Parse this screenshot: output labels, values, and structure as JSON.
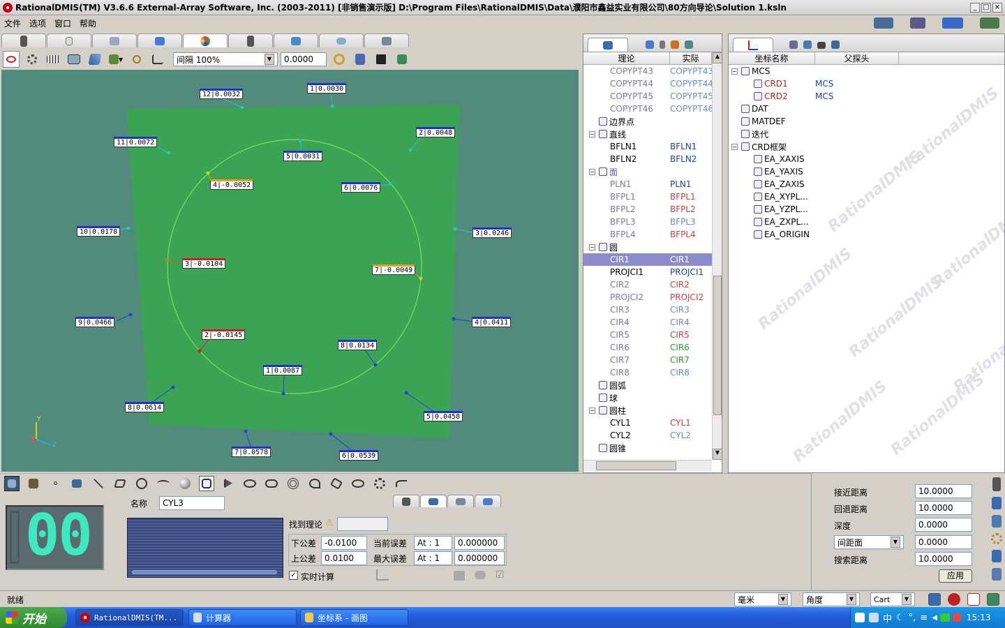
{
  "window": {
    "title": "RationalDMIS(TM) V3.6.6    External-Array Software, Inc. (2003-2011) [非销售演示版]          D:\\Program Files\\RationalDMIS\\Data\\濮阳市鑫益实业有限公司\\80方向导论\\Solution 1.ksln"
  },
  "menu": [
    "文件",
    "选项",
    "窗口",
    "帮助"
  ],
  "toolbar": {
    "mode_value": "间隔  100%",
    "number_value": "0.0000"
  },
  "viewport": {
    "labels": [
      {
        "text": "12|0.0032",
        "cls": ""
      },
      {
        "text": "1|0.0030",
        "cls": ""
      },
      {
        "text": "2|0.0048",
        "cls": ""
      },
      {
        "text": "11|0.0072",
        "cls": ""
      },
      {
        "text": "5|0.0031",
        "cls": ""
      },
      {
        "text": "4|-0.0052",
        "cls": "o"
      },
      {
        "text": "6|0.0076",
        "cls": ""
      },
      {
        "text": "10|0.0178",
        "cls": ""
      },
      {
        "text": "3|0.0246",
        "cls": ""
      },
      {
        "text": "3|-0.0104",
        "cls": "r"
      },
      {
        "text": "7|-0.0049",
        "cls": "o"
      },
      {
        "text": "9|0.0466",
        "cls": ""
      },
      {
        "text": "4|0.0411",
        "cls": ""
      },
      {
        "text": "2|-0.0145",
        "cls": "r"
      },
      {
        "text": "8|0.0134",
        "cls": ""
      },
      {
        "text": "1|0.0087",
        "cls": ""
      },
      {
        "text": "8|0.0614",
        "cls": ""
      },
      {
        "text": "5|0.0458",
        "cls": ""
      },
      {
        "text": "7|0.0578",
        "cls": ""
      },
      {
        "text": "6|0.0539",
        "cls": ""
      }
    ],
    "axis_y": "Y",
    "axis_z": "Z",
    "axis_x": "X"
  },
  "feature_panel": {
    "col_nominal": "理论",
    "col_actual": "实际",
    "rows": [
      {
        "indent": 2,
        "name": "COPYPT43",
        "actual": "COPYPT43",
        "nc": "#7a7a9a",
        "ac": "#6a8ad0",
        "icon": ""
      },
      {
        "indent": 2,
        "name": "COPYPT44",
        "actual": "COPYPT44",
        "nc": "#7a7a9a",
        "ac": "#6a8ad0",
        "icon": ""
      },
      {
        "indent": 2,
        "name": "COPYPT45",
        "actual": "COPYPT45",
        "nc": "#7a7a9a",
        "ac": "#6a8ad0",
        "icon": ""
      },
      {
        "indent": 2,
        "name": "COPYPT46",
        "actual": "COPYPT46",
        "nc": "#7a7a9a",
        "ac": "#6a8ad0",
        "icon": ""
      },
      {
        "indent": 1,
        "name": "边界点",
        "actual": "",
        "nc": "#000",
        "ac": "#000",
        "icon": "y"
      },
      {
        "indent": 1,
        "name": "直线",
        "actual": "",
        "nc": "#000",
        "ac": "#000",
        "icon": "y",
        "pm": "−"
      },
      {
        "indent": 2,
        "name": "BFLN1",
        "actual": "BFLN1",
        "nc": "#000",
        "ac": "#1a3fb0",
        "icon": ""
      },
      {
        "indent": 2,
        "name": "BFLN2",
        "actual": "BFLN2",
        "nc": "#000",
        "ac": "#1a3fb0",
        "icon": ""
      },
      {
        "indent": 1,
        "name": "面",
        "actual": "",
        "nc": "#5a5aa0",
        "ac": "#000",
        "icon": "y",
        "pm": "−"
      },
      {
        "indent": 2,
        "name": "PLN1",
        "actual": "PLN1",
        "nc": "#7a7a9a",
        "ac": "#1a3fb0",
        "icon": ""
      },
      {
        "indent": 2,
        "name": "BFPL1",
        "actual": "BFPL1",
        "nc": "#7a7a9a",
        "ac": "#d04040",
        "icon": ""
      },
      {
        "indent": 2,
        "name": "BFPL2",
        "actual": "BFPL2",
        "nc": "#7a7a9a",
        "ac": "#d04040",
        "icon": ""
      },
      {
        "indent": 2,
        "name": "BFPL3",
        "actual": "BFPL3",
        "nc": "#7a7a9a",
        "ac": "#6a8ad0",
        "icon": ""
      },
      {
        "indent": 2,
        "name": "BFPL4",
        "actual": "BFPL4",
        "nc": "#7a7a9a",
        "ac": "#d04040",
        "icon": ""
      },
      {
        "indent": 1,
        "name": "圆",
        "actual": "",
        "nc": "#000",
        "ac": "#000",
        "icon": "y",
        "pm": "−"
      },
      {
        "indent": 2,
        "name": "CIR1",
        "actual": "CIR1",
        "nc": "#fff",
        "ac": "#fff",
        "icon": "",
        "sel": true
      },
      {
        "indent": 2,
        "name": "PROJCI1",
        "actual": "PROJCI1",
        "nc": "#000",
        "ac": "#1a3fb0",
        "icon": ""
      },
      {
        "indent": 2,
        "name": "CIR2",
        "actual": "CIR2",
        "nc": "#7a7a9a",
        "ac": "#d04040",
        "icon": ""
      },
      {
        "indent": 2,
        "name": "PROJCI2",
        "actual": "PROJCI2",
        "nc": "#7a7a9a",
        "ac": "#d04040",
        "icon": ""
      },
      {
        "indent": 2,
        "name": "CIR3",
        "actual": "CIR3",
        "nc": "#7a7a9a",
        "ac": "#6a8ad0",
        "icon": ""
      },
      {
        "indent": 2,
        "name": "CIR4",
        "actual": "CIR4",
        "nc": "#7a7a9a",
        "ac": "#6a8ad0",
        "icon": ""
      },
      {
        "indent": 2,
        "name": "CIR5",
        "actual": "CIR5",
        "nc": "#7a7a9a",
        "ac": "#d04040",
        "icon": ""
      },
      {
        "indent": 2,
        "name": "CIR6",
        "actual": "CIR6",
        "nc": "#7a7a9a",
        "ac": "#2a9a3a",
        "icon": ""
      },
      {
        "indent": 2,
        "name": "CIR7",
        "actual": "CIR7",
        "nc": "#7a7a9a",
        "ac": "#2a9a3a",
        "icon": ""
      },
      {
        "indent": 2,
        "name": "CIR8",
        "actual": "CIR8",
        "nc": "#7a7a9a",
        "ac": "#6a8ad0",
        "icon": ""
      },
      {
        "indent": 1,
        "name": "圆弧",
        "actual": "",
        "nc": "#000",
        "ac": "#000",
        "icon": "y"
      },
      {
        "indent": 1,
        "name": "球",
        "actual": "",
        "nc": "#000",
        "ac": "#000",
        "icon": "y"
      },
      {
        "indent": 1,
        "name": "圆柱",
        "actual": "",
        "nc": "#000",
        "ac": "#000",
        "icon": "y",
        "pm": "−"
      },
      {
        "indent": 2,
        "name": "CYL1",
        "actual": "CYL1",
        "nc": "#000",
        "ac": "#d04040",
        "icon": ""
      },
      {
        "indent": 2,
        "name": "CYL2",
        "actual": "CYL2",
        "nc": "#000",
        "ac": "#6a8ad0",
        "icon": ""
      },
      {
        "indent": 1,
        "name": "圆锥",
        "actual": "",
        "nc": "#000",
        "ac": "#000",
        "icon": "y"
      }
    ]
  },
  "coord_panel": {
    "col_name": "坐标名称",
    "col_parent": "父探头",
    "rows": [
      {
        "indent": 0,
        "name": "MCS",
        "parent": "",
        "nc": "#000",
        "pm": "−"
      },
      {
        "indent": 1,
        "name": "CRD1",
        "parent": "MCS",
        "nc": "#c02020"
      },
      {
        "indent": 1,
        "name": "CRD2",
        "parent": "MCS",
        "nc": "#c02020"
      },
      {
        "indent": 0,
        "name": "DAT",
        "parent": "",
        "nc": "#000"
      },
      {
        "indent": 0,
        "name": "MATDEF",
        "parent": "",
        "nc": "#000"
      },
      {
        "indent": 0,
        "name": "迭代",
        "parent": "",
        "nc": "#000"
      },
      {
        "indent": 0,
        "name": "CRD框架",
        "parent": "",
        "nc": "#000",
        "pm": "−"
      },
      {
        "indent": 1,
        "name": "EA_XAXIS",
        "parent": "",
        "nc": "#000"
      },
      {
        "indent": 1,
        "name": "EA_YAXIS",
        "parent": "",
        "nc": "#000"
      },
      {
        "indent": 1,
        "name": "EA_ZAXIS",
        "parent": "",
        "nc": "#000"
      },
      {
        "indent": 1,
        "name": "EA_XYPL...",
        "parent": "",
        "nc": "#000"
      },
      {
        "indent": 1,
        "name": "EA_YZPL...",
        "parent": "",
        "nc": "#000"
      },
      {
        "indent": 1,
        "name": "EA_ZXPL...",
        "parent": "",
        "nc": "#000"
      },
      {
        "indent": 1,
        "name": "EA_ORIGIN",
        "parent": "",
        "nc": "#000"
      }
    ],
    "watermark": "RationalDMIS"
  },
  "measure": {
    "counter": "00",
    "name_label": "名称",
    "name_value": "CYL3",
    "find_nominal": "找到理论",
    "lower_tol_label": "下公差",
    "lower_tol": "-0.0100",
    "upper_tol_label": "上公差",
    "upper_tol": "0.0100",
    "cur_err_label": "当前误差",
    "cur_at": "At : 1",
    "cur_val": "0.000000",
    "max_err_label": "最大误差",
    "max_at": "At : 1",
    "max_val": "0.000000",
    "realtime": "实时计算"
  },
  "params": {
    "approach_label": "接近距离",
    "approach": "10.0000",
    "retract_label": "回退距离",
    "retract": "10.0000",
    "depth_label": "深度",
    "depth": "0.0000",
    "spacing_sel": "间距面",
    "spacing": "0.0000",
    "search_label": "搜索距离",
    "search": "10.0000",
    "apply": "应用"
  },
  "status": {
    "text": "就绪",
    "unit": "毫米",
    "angle": "角度",
    "coord": "Cart"
  },
  "taskbar": {
    "start": "开始",
    "task1": "RationalDMIS(TM...",
    "task2": "计算器",
    "task3": "坐标系 - 画图",
    "lang": "中",
    "time": "15:13"
  }
}
